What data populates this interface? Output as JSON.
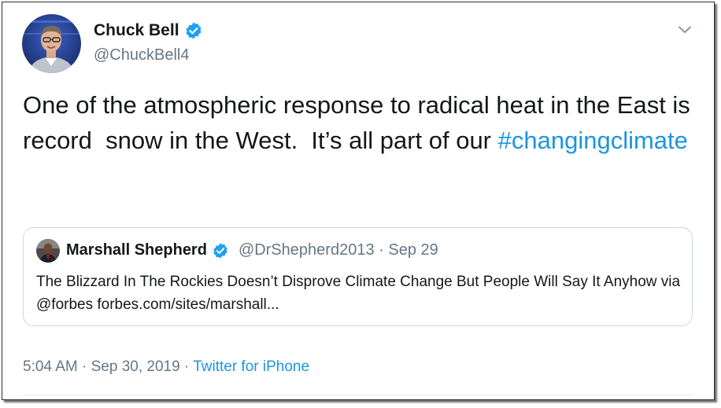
{
  "author": {
    "name": "Chuck Bell",
    "handle": "@ChuckBell4",
    "verified": true
  },
  "tweet": {
    "text": "One of the atmospheric response to radical heat in the East is record  snow in the West.  It’s all part of our ",
    "hashtag": "#changingclimate"
  },
  "quoted_tweet": {
    "name": "Marshall Shepherd",
    "verified": true,
    "handle": "@DrShepherd2013",
    "separator": " · ",
    "date": "Sep 29",
    "text": "The Blizzard In The Rockies Doesn’t Disprove Climate Change But People Will Say It Anyhow via @forbes forbes.com/sites/marshall..."
  },
  "footer": {
    "time": "5:04 AM",
    "separator": " · ",
    "date": "Sep 30, 2019",
    "separator2": " · ",
    "source": "Twitter for iPhone"
  },
  "colors": {
    "link": "#1b95e0",
    "verified": "#1da1f2",
    "text": "#14171a",
    "muted": "#657786",
    "border": "#ccd6dd"
  },
  "icons": {
    "verified": "verified-badge-icon",
    "menu": "chevron-down-icon"
  }
}
